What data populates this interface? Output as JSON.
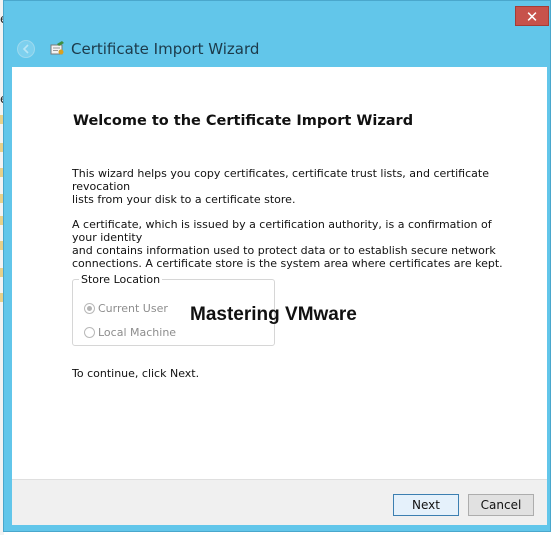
{
  "background": {
    "letter_a": "e",
    "letter_b": "e"
  },
  "window": {
    "title": "Certificate Import Wizard",
    "close_glyph": "✕",
    "close_color": "#c7524b",
    "titlebar_color": "#62c6ea",
    "icons": {
      "back": "back-arrow-icon",
      "wizard": "certificate-wizard-icon",
      "close": "close-icon"
    }
  },
  "content": {
    "heading": "Welcome to the Certificate Import Wizard",
    "para1_line1": "This wizard helps you copy certificates, certificate trust lists, and certificate revocation",
    "para1_line2": "lists from your disk to a certificate store.",
    "para2_line1": "A certificate, which is issued by a certification authority, is a confirmation of your identity",
    "para2_line2": "and contains information used to protect data or to establish secure network",
    "para2_line3": "connections. A certificate store is the system area where certificates are kept.",
    "store_location": {
      "label": "Store Location",
      "options": [
        {
          "label": "Current User",
          "checked": true
        },
        {
          "label": "Local Machine",
          "checked": false
        }
      ]
    },
    "watermark": "Mastering VMware",
    "continue_text": "To continue, click Next."
  },
  "footer": {
    "next_label": "Next",
    "cancel_label": "Cancel"
  }
}
